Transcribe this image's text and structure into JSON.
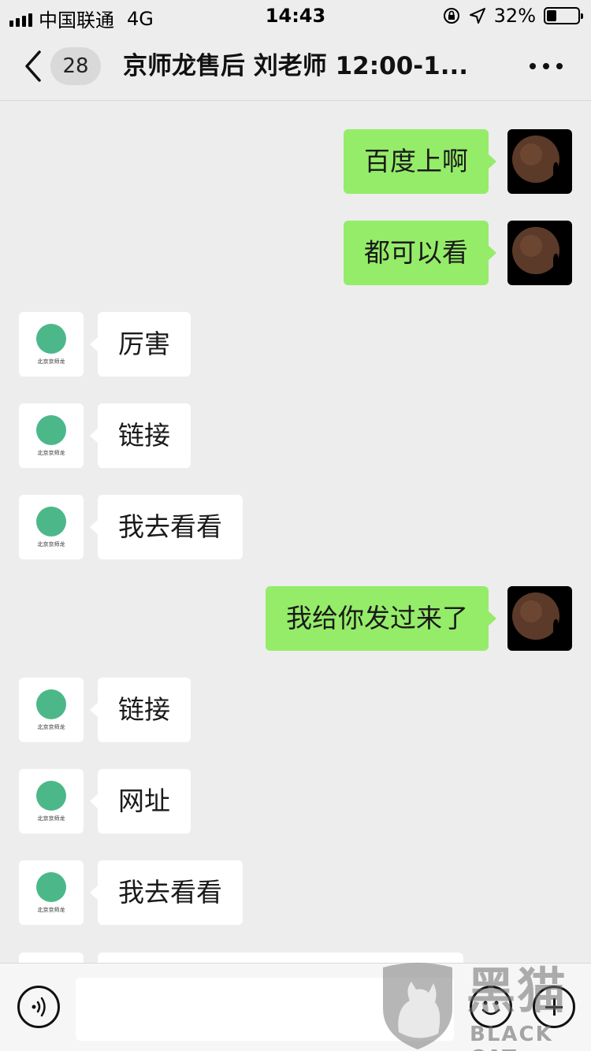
{
  "status_bar": {
    "carrier": "中国联通",
    "network": "4G",
    "time": "14:43",
    "battery": "32%",
    "battery_level": 0.32
  },
  "nav": {
    "unread_count": "28",
    "title": "京师龙售后 刘老师 12:00-1..."
  },
  "messages": [
    {
      "side": "right",
      "text": "百度上啊"
    },
    {
      "side": "right",
      "text": "都可以看"
    },
    {
      "side": "left",
      "text": "厉害"
    },
    {
      "side": "left",
      "text": "链接"
    },
    {
      "side": "left",
      "text": "我去看看"
    },
    {
      "side": "right",
      "text": "我给你发过来了"
    },
    {
      "side": "left",
      "text": "链接"
    },
    {
      "side": "left",
      "text": "网址"
    },
    {
      "side": "left",
      "text": "我去看看"
    }
  ],
  "avatar_logo_text": "北京京师龙",
  "input": {
    "value": ""
  },
  "watermark": {
    "title": "黑猫",
    "subtitle": "BLACK CAT"
  },
  "colors": {
    "background": "#ededed",
    "outgoing_bubble": "#95ec69",
    "incoming_bubble": "#ffffff",
    "logo_green": "#4cb88a"
  }
}
